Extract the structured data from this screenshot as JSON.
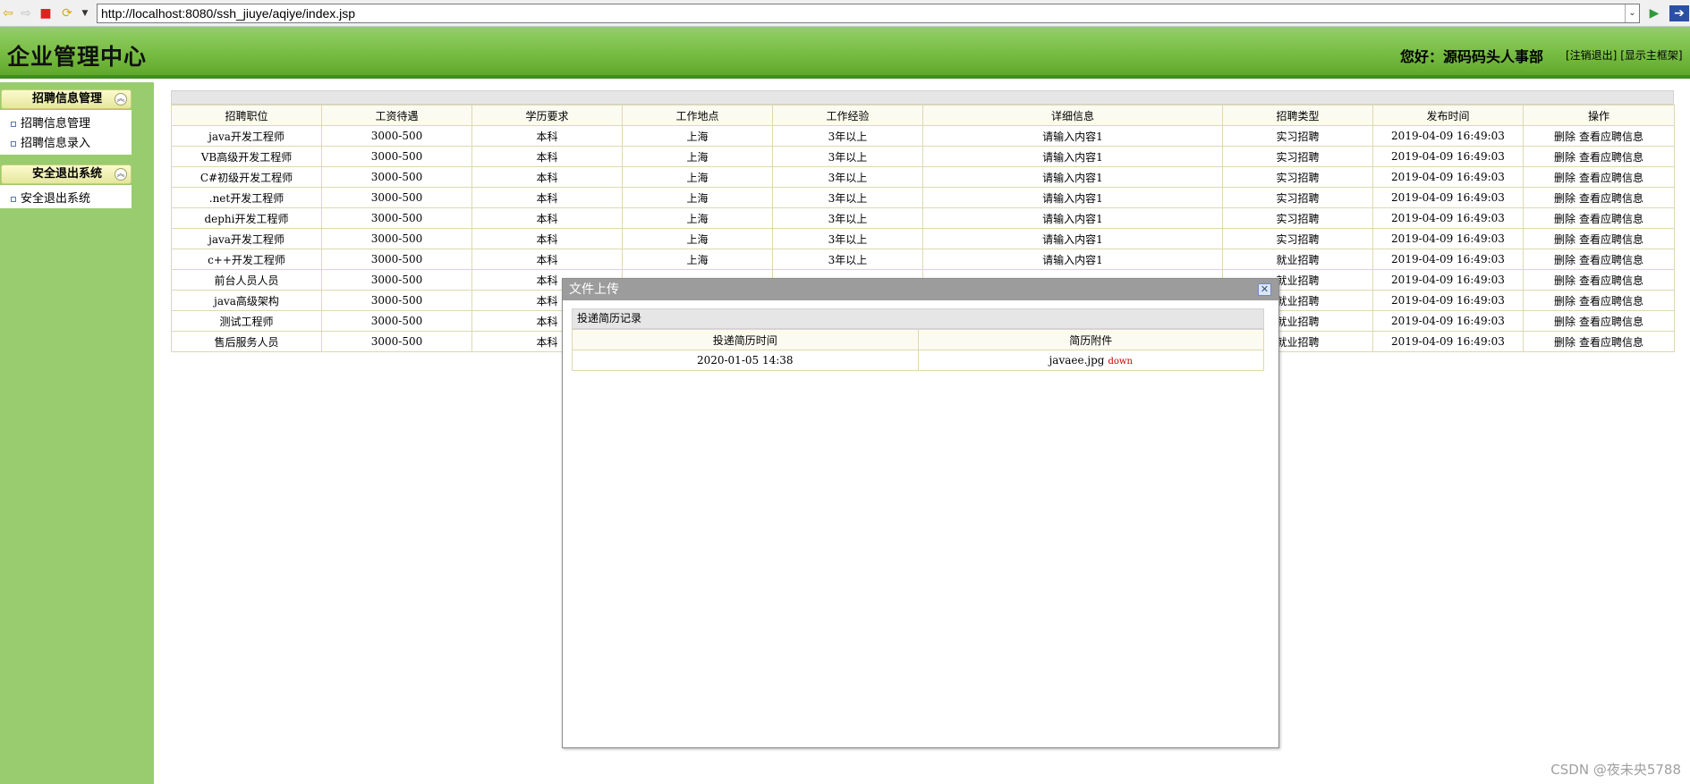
{
  "browser": {
    "url": "http://localhost:8080/ssh_jiuye/aqiye/index.jsp"
  },
  "header": {
    "title": "企业管理中心",
    "greeting": "您好：源码码头人事部",
    "logout_link": "[注销退出]",
    "show_frame_link": "[显示主框架]"
  },
  "sidebar": {
    "groups": [
      {
        "title": "招聘信息管理",
        "items": [
          "招聘信息管理",
          "招聘信息录入"
        ]
      },
      {
        "title": "安全退出系统",
        "items": [
          "安全退出系统"
        ]
      }
    ]
  },
  "table": {
    "columns": [
      "招聘职位",
      "工资待遇",
      "学历要求",
      "工作地点",
      "工作经验",
      "详细信息",
      "招聘类型",
      "发布时间",
      "操作"
    ],
    "rows": [
      [
        "java开发工程师",
        "3000-500",
        "本科",
        "上海",
        "3年以上",
        "请输入内容1",
        "实习招聘",
        "2019-04-09 16:49:03"
      ],
      [
        "VB高级开发工程师",
        "3000-500",
        "本科",
        "上海",
        "3年以上",
        "请输入内容1",
        "实习招聘",
        "2019-04-09 16:49:03"
      ],
      [
        "C#初级开发工程师",
        "3000-500",
        "本科",
        "上海",
        "3年以上",
        "请输入内容1",
        "实习招聘",
        "2019-04-09 16:49:03"
      ],
      [
        ".net开发工程师",
        "3000-500",
        "本科",
        "上海",
        "3年以上",
        "请输入内容1",
        "实习招聘",
        "2019-04-09 16:49:03"
      ],
      [
        "dephi开发工程师",
        "3000-500",
        "本科",
        "上海",
        "3年以上",
        "请输入内容1",
        "实习招聘",
        "2019-04-09 16:49:03"
      ],
      [
        "java开发工程师",
        "3000-500",
        "本科",
        "上海",
        "3年以上",
        "请输入内容1",
        "实习招聘",
        "2019-04-09 16:49:03"
      ],
      [
        "c++开发工程师",
        "3000-500",
        "本科",
        "上海",
        "3年以上",
        "请输入内容1",
        "就业招聘",
        "2019-04-09 16:49:03"
      ],
      [
        "前台人员人员",
        "3000-500",
        "本科",
        "",
        "",
        "",
        "就业招聘",
        "2019-04-09 16:49:03"
      ],
      [
        "java高级架构",
        "3000-500",
        "本科",
        "",
        "",
        "",
        "就业招聘",
        "2019-04-09 16:49:03"
      ],
      [
        "测试工程师",
        "3000-500",
        "本科",
        "",
        "",
        "",
        "就业招聘",
        "2019-04-09 16:49:03"
      ],
      [
        "售后服务人员",
        "3000-500",
        "本科",
        "",
        "",
        "",
        "就业招聘",
        "2019-04-09 16:49:03"
      ]
    ],
    "action_delete": "删除",
    "action_view": "查看应聘信息"
  },
  "dialog": {
    "title": "文件上传",
    "section_title": "投递简历记录",
    "columns": [
      "投递简历时间",
      "简历附件"
    ],
    "rows": [
      {
        "time": "2020-01-05 14:38",
        "file": "javaee.jpg",
        "link": "down"
      }
    ]
  },
  "watermark": "CSDN @夜未央5788"
}
